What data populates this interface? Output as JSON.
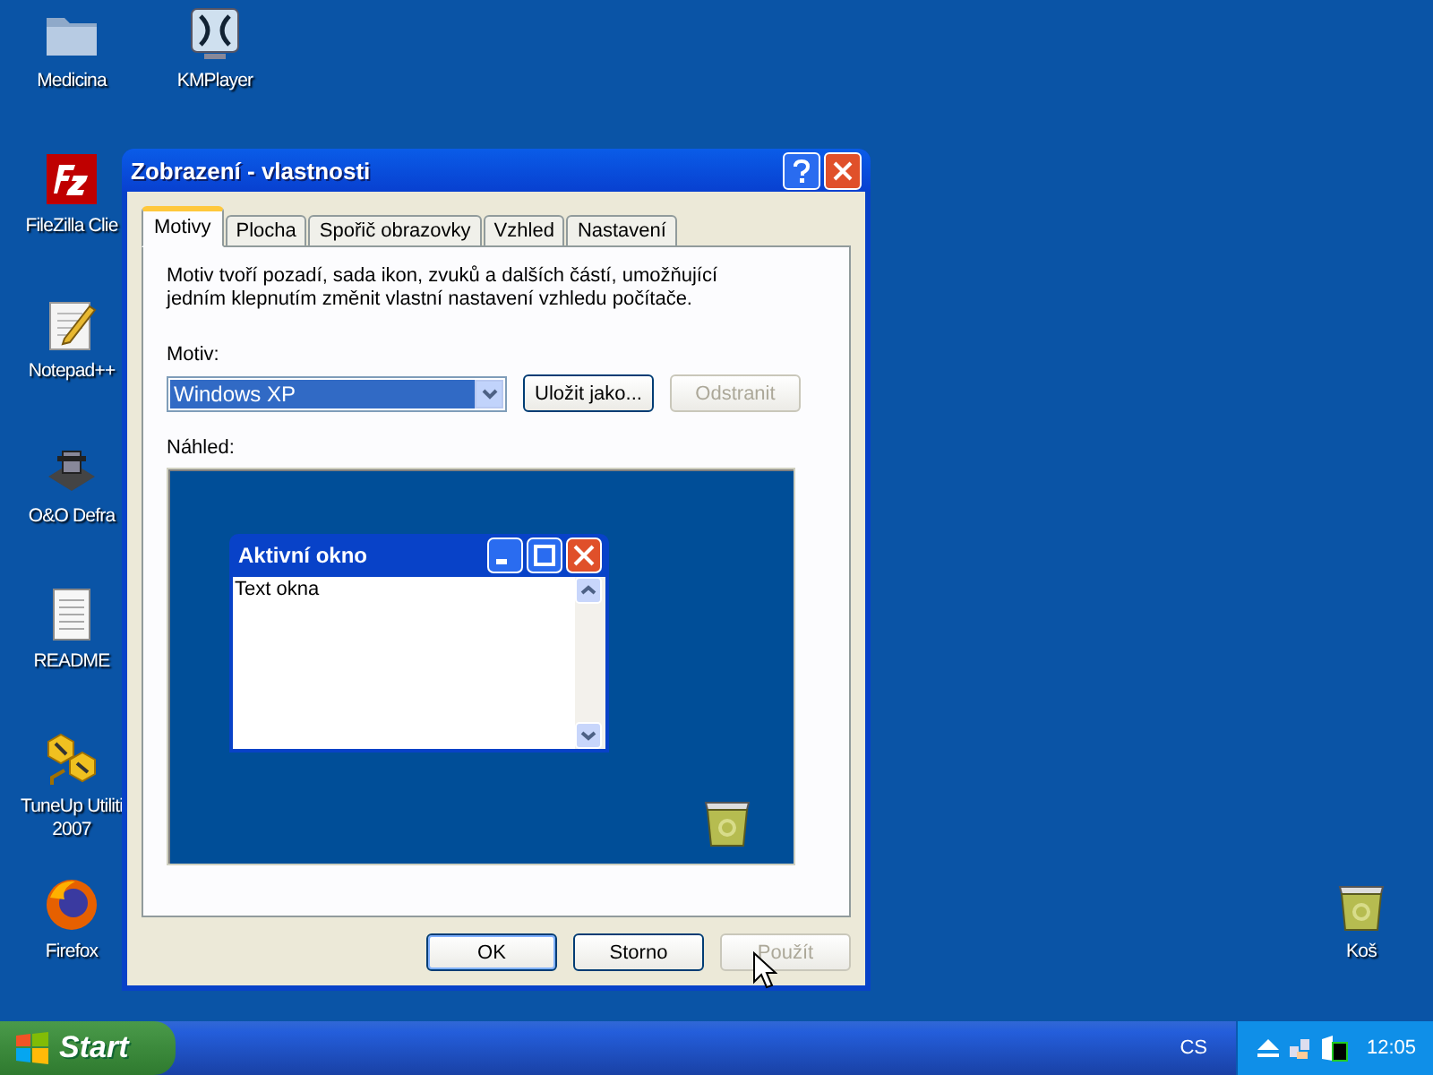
{
  "desktop": {
    "icons": [
      {
        "label": "Medicina",
        "kind": "folder"
      },
      {
        "label": "KMPlayer",
        "kind": "player"
      },
      {
        "label": "FileZilla Clie",
        "kind": "filezilla"
      },
      {
        "label": "Notepad++",
        "kind": "notepad"
      },
      {
        "label": "O&O Defra",
        "kind": "defrag"
      },
      {
        "label": "README",
        "kind": "document"
      },
      {
        "label": "TuneUp Utiliti 2007",
        "kind": "tuneup"
      },
      {
        "label": "Firefox",
        "kind": "firefox"
      },
      {
        "label": "Koš",
        "kind": "recycle"
      }
    ]
  },
  "dialog": {
    "title": "Zobrazení - vlastnosti",
    "tabs": [
      {
        "label": "Motivy",
        "selected": true
      },
      {
        "label": "Plocha",
        "selected": false
      },
      {
        "label": "Spořič obrazovky",
        "selected": false
      },
      {
        "label": "Vzhled",
        "selected": false
      },
      {
        "label": "Nastavení",
        "selected": false
      }
    ],
    "description": "Motiv tvoří pozadí, sada ikon, zvuků a dalších částí, umožňující jedním klepnutím změnit vlastní nastavení vzhledu počítače.",
    "theme_label": "Motiv:",
    "theme_value": "Windows XP",
    "side_buttons": [
      {
        "label": "Uložit jako...",
        "disabled": false
      },
      {
        "label": "Odstranit",
        "disabled": true
      }
    ],
    "preview_label": "Náhled:",
    "preview": {
      "window_title": "Aktivní okno",
      "window_text": "Text okna"
    },
    "buttons": [
      {
        "label": "OK",
        "disabled": false,
        "default": true
      },
      {
        "label": "Storno",
        "disabled": false,
        "default": false
      },
      {
        "label": "Použít",
        "disabled": true,
        "default": false
      }
    ]
  },
  "taskbar": {
    "start": "Start",
    "language": "CS",
    "time": "12:05"
  }
}
